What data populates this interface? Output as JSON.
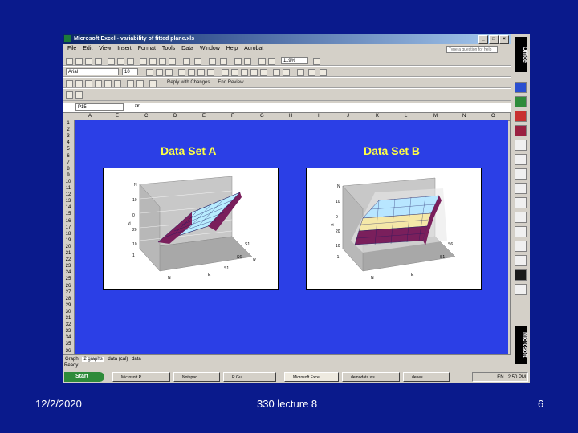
{
  "app": {
    "title": "Microsoft Excel - variability of fitted plane.xls",
    "menus": [
      "File",
      "Edit",
      "View",
      "Insert",
      "Format",
      "Tools",
      "Data",
      "Window",
      "Help",
      "Acrobat"
    ],
    "help_placeholder": "Type a question for help",
    "font_name": "Arial",
    "font_size": "10",
    "zoom": "119%",
    "reply_label": "Reply with Changes...",
    "end_review_label": "End Review...",
    "name_box": "P15",
    "fx_label": "fx",
    "columns": [
      "A",
      "E",
      "C",
      "D",
      "E",
      "F",
      "G",
      "H",
      "I",
      "J",
      "K",
      "L",
      "M",
      "N",
      "O"
    ],
    "rows": [
      "1",
      "2",
      "3",
      "4",
      "5",
      "6",
      "7",
      "8",
      "9",
      "10",
      "11",
      "12",
      "13",
      "14",
      "15",
      "16",
      "17",
      "18",
      "19",
      "20",
      "21",
      "22",
      "23",
      "24",
      "25",
      "26",
      "27",
      "28",
      "29",
      "30",
      "31",
      "32",
      "33",
      "34",
      "35",
      "36"
    ],
    "sheet_tabs": [
      "Graph",
      "2 graphs",
      "data (cal)",
      "data"
    ],
    "status": "Ready"
  },
  "charts": [
    {
      "title": "Data Set A",
      "style": "tilted-plane",
      "surface_color": "#7a1f5c",
      "mesh_color": "#9fe0ff"
    },
    {
      "title": "Data Set B",
      "style": "flat-layers",
      "layer_colors": [
        "#7a1f5c",
        "#f5e8a8",
        "#b8e6ff"
      ]
    }
  ],
  "taskbar": {
    "start": "Start",
    "tasks": [
      "Microsoft P...",
      "Notepad",
      "R Gui",
      "Microsoft Excel",
      "demodata.xls",
      "denes"
    ],
    "tray_time": "2:50 PM",
    "tray_lang": "EN"
  },
  "office_bar": {
    "top_label": "Office",
    "bottom_label": "Microsoft"
  },
  "footer": {
    "date": "12/2/2020",
    "center": "330 lecture 8",
    "page": "6"
  }
}
